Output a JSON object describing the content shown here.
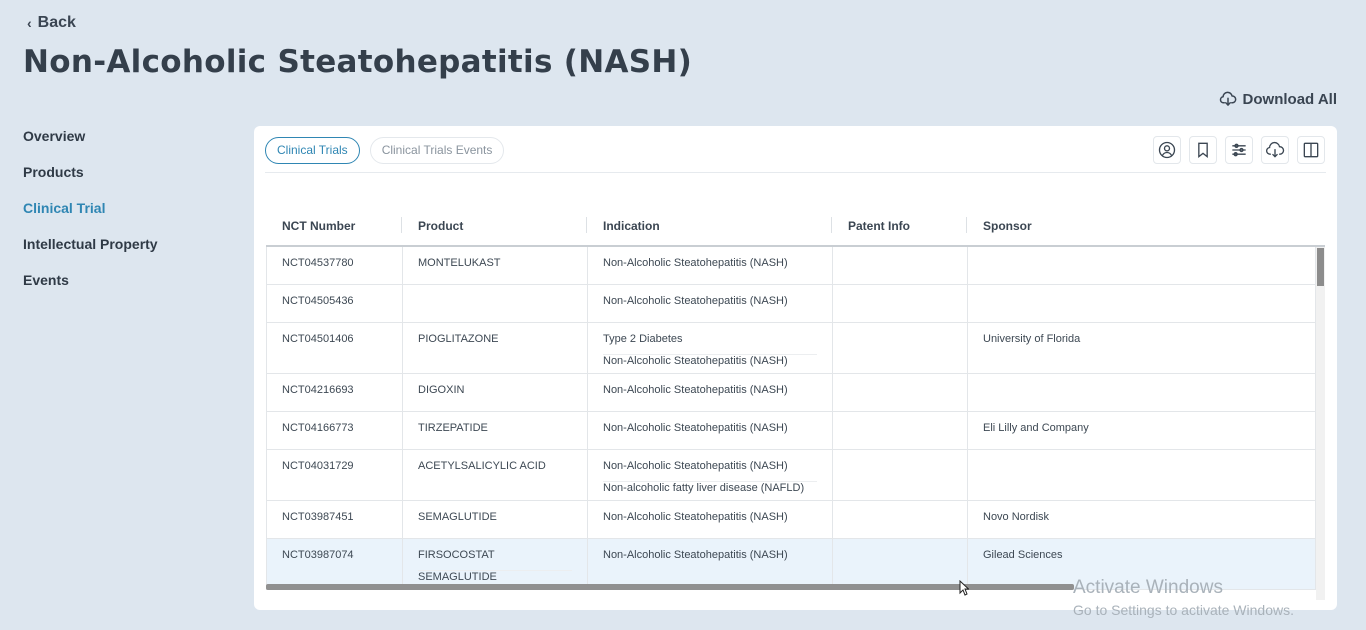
{
  "nav": {
    "back_label": "Back"
  },
  "page": {
    "title": "Non-Alcoholic Steatohepatitis (NASH)",
    "download_all_label": "Download All"
  },
  "sidebar": {
    "items": [
      {
        "label": "Overview",
        "active": false
      },
      {
        "label": "Products",
        "active": false
      },
      {
        "label": "Clinical Trial",
        "active": true
      },
      {
        "label": "Intellectual Property",
        "active": false
      },
      {
        "label": "Events",
        "active": false
      }
    ]
  },
  "tabs": [
    {
      "label": "Clinical Trials",
      "active": true
    },
    {
      "label": "Clinical Trials Events",
      "active": false
    }
  ],
  "toolbar": {
    "icons": [
      "user-circle-icon",
      "bookmark-icon",
      "filter-sliders-icon",
      "cloud-download-icon",
      "columns-icon"
    ]
  },
  "table": {
    "headers": [
      "NCT Number",
      "Product",
      "Indication",
      "Patent Info",
      "Sponsor"
    ],
    "rows": [
      {
        "nct": "NCT04537780",
        "product": [
          "MONTELUKAST"
        ],
        "indication": [
          "Non-Alcoholic Steatohepatitis (NASH)"
        ],
        "patent": "",
        "sponsor": ""
      },
      {
        "nct": "NCT04505436",
        "product": [],
        "indication": [
          "Non-Alcoholic Steatohepatitis (NASH)"
        ],
        "patent": "",
        "sponsor": ""
      },
      {
        "nct": "NCT04501406",
        "product": [
          "PIOGLITAZONE"
        ],
        "indication": [
          "Type 2 Diabetes",
          "Non-Alcoholic Steatohepatitis (NASH)"
        ],
        "patent": "",
        "sponsor": "University of Florida"
      },
      {
        "nct": "NCT04216693",
        "product": [
          "DIGOXIN"
        ],
        "indication": [
          "Non-Alcoholic Steatohepatitis (NASH)"
        ],
        "patent": "",
        "sponsor": ""
      },
      {
        "nct": "NCT04166773",
        "product": [
          "TIRZEPATIDE"
        ],
        "indication": [
          "Non-Alcoholic Steatohepatitis (NASH)"
        ],
        "patent": "",
        "sponsor": "Eli Lilly and Company"
      },
      {
        "nct": "NCT04031729",
        "product": [
          "ACETYLSALICYLIC ACID"
        ],
        "indication": [
          "Non-Alcoholic Steatohepatitis (NASH)",
          "Non-alcoholic fatty liver disease (NAFLD)"
        ],
        "patent": "",
        "sponsor": ""
      },
      {
        "nct": "NCT03987451",
        "product": [
          "SEMAGLUTIDE"
        ],
        "indication": [
          "Non-Alcoholic Steatohepatitis (NASH)"
        ],
        "patent": "",
        "sponsor": "Novo Nordisk"
      },
      {
        "nct": "NCT03987074",
        "product": [
          "FIRSOCOSTAT",
          "SEMAGLUTIDE"
        ],
        "indication": [
          "Non-Alcoholic Steatohepatitis (NASH)"
        ],
        "patent": "",
        "sponsor": "Gilead Sciences",
        "highlight": true
      }
    ]
  },
  "watermark": {
    "title": "Activate Windows",
    "subtitle": "Go to Settings to activate Windows."
  },
  "colors": {
    "accent": "#2f86b3",
    "background": "#dde6ef",
    "row_highlight": "#eaf3fb"
  }
}
